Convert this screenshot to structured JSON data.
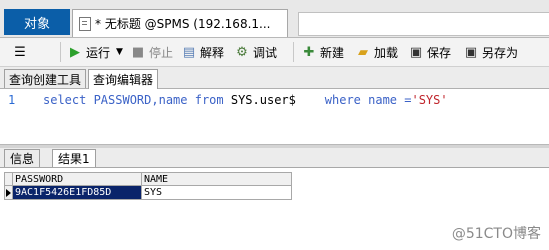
{
  "window": {
    "object_tab_label": "对象",
    "doc_tab_title": "* 无标题 @SPMS (192.168.1..."
  },
  "toolbar": {
    "run_label": "运行",
    "stop_label": "停止",
    "explain_label": "解释",
    "debug_label": "调试",
    "new_label": "新建",
    "load_label": "加载",
    "save_label": "保存",
    "save_as_label": "另存为"
  },
  "subtabs": [
    "查询创建工具",
    "查询编辑器"
  ],
  "editor": {
    "line_number": "1",
    "code_tokens": [
      {
        "t": "select PASSWORD,name ",
        "c": "kw"
      },
      {
        "t": "from",
        "c": "kw"
      },
      {
        "t": " SYS.user$    ",
        "c": ""
      },
      {
        "t": "where",
        "c": "kw"
      },
      {
        "t": " name =",
        "c": "kw"
      },
      {
        "t": "'SYS'",
        "c": "str"
      }
    ]
  },
  "bottom_tabs": [
    "信息",
    "结果1"
  ],
  "result": {
    "columns": [
      "PASSWORD",
      "NAME"
    ],
    "rows": [
      [
        "9AC1F5426E1FD85D",
        "SYS"
      ]
    ]
  },
  "colors": {
    "accent": "#0b5ea8",
    "keyword": "#3b62c7",
    "string": "#c0242b",
    "selection": "#0a246a"
  },
  "icons": [
    "menu-icon",
    "play-icon",
    "stop-icon",
    "explain-icon",
    "debug-icon",
    "new-icon",
    "load-icon",
    "save-icon",
    "save-as-icon",
    "row-pointer-icon"
  ],
  "watermark": "@51CTO博客"
}
